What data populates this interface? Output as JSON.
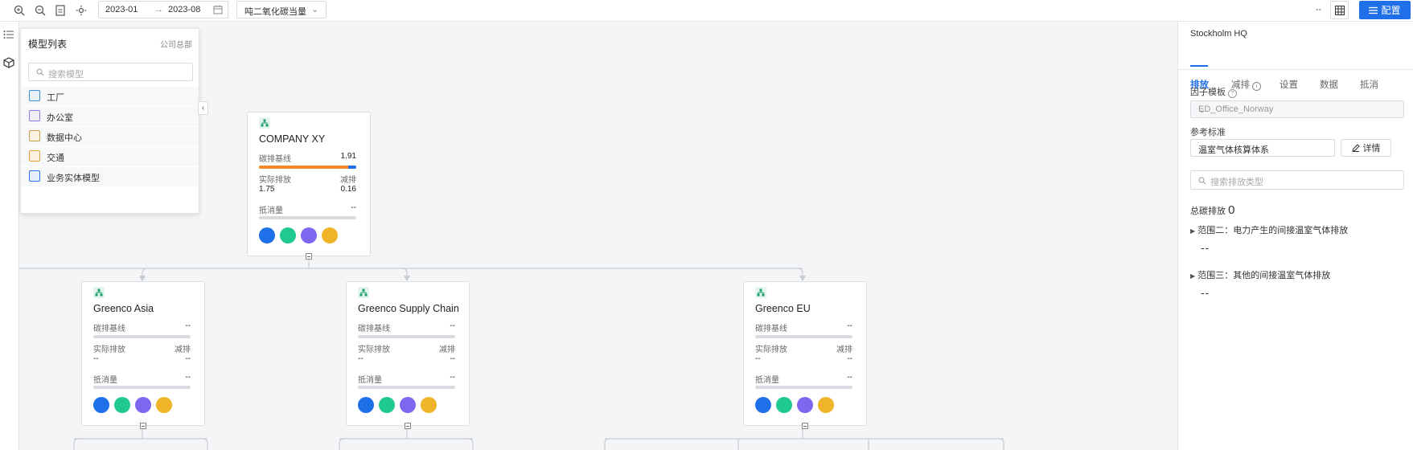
{
  "toolbar": {
    "date_start": "2023-01",
    "date_arrow": "→",
    "date_end": "2023-08",
    "unit": "吨二氧化碳当量",
    "dash": "--",
    "config_label": "配置"
  },
  "library": {
    "title": "模型列表",
    "subtitle": "公司总部",
    "search_placeholder": "搜索模型",
    "items": [
      {
        "label": "工厂",
        "color": "#3d8fd6"
      },
      {
        "label": "办公室",
        "color": "#8a7be0"
      },
      {
        "label": "数据中心",
        "color": "#c9a04b"
      },
      {
        "label": "交通",
        "color": "#e0a23c"
      },
      {
        "label": "业务实体模型",
        "color": "#2f6fe0"
      }
    ]
  },
  "cards": [
    {
      "name": "COMPANY XY",
      "baseline_label": "碳排基线",
      "baseline_value": "1.91",
      "baseline_fill": 0.92,
      "actual_label": "实际排放",
      "reduce_label": "减排",
      "actual_value": "1.75",
      "reduce_value": "0.16",
      "offset_label": "抵消量",
      "offset_value": "--"
    },
    {
      "name": "Greenco Asia",
      "baseline_label": "碳排基线",
      "baseline_value": "--",
      "baseline_fill": 0,
      "actual_label": "实际排放",
      "reduce_label": "减排",
      "actual_value": "--",
      "reduce_value": "--",
      "offset_label": "抵消量",
      "offset_value": "--"
    },
    {
      "name": "Greenco Supply Chain",
      "baseline_label": "碳排基线",
      "baseline_value": "--",
      "baseline_fill": 0,
      "actual_label": "实际排放",
      "reduce_label": "减排",
      "actual_value": "--",
      "reduce_value": "--",
      "offset_label": "抵消量",
      "offset_value": "--"
    },
    {
      "name": "Greenco EU",
      "baseline_label": "碳排基线",
      "baseline_value": "--",
      "baseline_fill": 0,
      "actual_label": "实际排放",
      "reduce_label": "减排",
      "actual_value": "--",
      "reduce_value": "--",
      "offset_label": "抵消量",
      "offset_value": "--"
    }
  ],
  "dot_colors": [
    "#1f6fe8",
    "#1fc98f",
    "#7b68ee",
    "#f0b429"
  ],
  "panel": {
    "title": "Stockholm HQ",
    "tabs": [
      "排放",
      "减排",
      "设置",
      "数据",
      "抵消"
    ],
    "factor_label": "因子模板",
    "factor_value": "ED_Office_Norway",
    "standard_label": "参考标准",
    "standard_value": "温室气体核算体系",
    "detail_label": "详情",
    "search_placeholder": "搜索排放类型",
    "total_label": "总碳排放",
    "total_value": "0",
    "scope2_label": "范围二：电力产生的间接温室气体排放",
    "scope2_value": "--",
    "scope3_label": "范围三：其他的间接温室气体排放",
    "scope3_value": "--"
  }
}
